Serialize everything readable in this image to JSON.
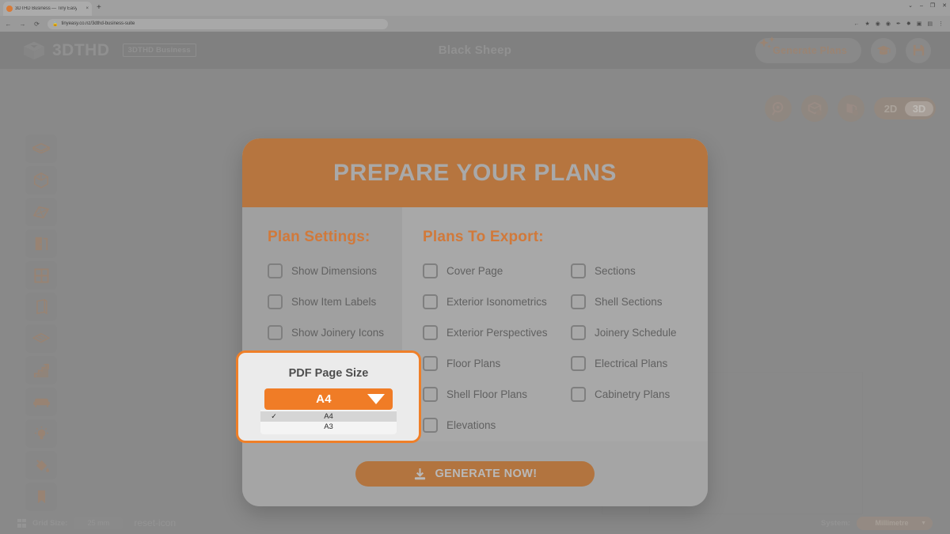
{
  "browser": {
    "tab_title": "3DTHD Business — Tiny Easy - T",
    "tab_favicon": "app-favicon",
    "close_tab": "×",
    "new_tab": "+",
    "back": "←",
    "forward": "→",
    "reload": "⟳",
    "lock": "🔒",
    "url": "tinyeasy.co.nz/3dthd-business-suite",
    "extensions": [
      "←",
      "★",
      "◉",
      "◉",
      "✒",
      "✸",
      "▣",
      "▤",
      "⋮"
    ],
    "window_buttons": [
      "⌄",
      "–",
      "❐",
      "✕"
    ]
  },
  "header": {
    "brand_name": "3DTHD",
    "brand_badge": "3DTHD Business",
    "logo_icon": "cube-logo-icon",
    "project_title": "Black Sheep",
    "generate_plans_label": "Generate Plans",
    "sparkle_icon": "sparkles-icon",
    "tutorial_icon": "graduation-cap-icon",
    "save_icon": "floppy-save-icon"
  },
  "toolrail": {
    "items": [
      {
        "name": "floor-tool",
        "icon": "floor-slab-icon"
      },
      {
        "name": "room-tool",
        "icon": "room-box-icon"
      },
      {
        "name": "roof-tool",
        "icon": "roof-icon"
      },
      {
        "name": "door-tool",
        "icon": "door-icon"
      },
      {
        "name": "window-tool",
        "icon": "window-icon"
      },
      {
        "name": "wall-tool",
        "icon": "wall-icon"
      },
      {
        "name": "deck-tool",
        "icon": "deck-icon"
      },
      {
        "name": "stairs-tool",
        "icon": "stairs-icon"
      },
      {
        "name": "furniture-tool",
        "icon": "sofa-icon"
      },
      {
        "name": "lighting-tool",
        "icon": "lightbulb-icon"
      },
      {
        "name": "paint-tool",
        "icon": "paint-bucket-icon"
      },
      {
        "name": "bookmark-tool",
        "icon": "bookmark-icon"
      }
    ]
  },
  "view_controls": {
    "measure_icon": "tape-measure-icon",
    "shell_icon": "shell-view-icon",
    "perspective_icon": "perspective-view-icon",
    "dimension_2d": "2D",
    "dimension_3d": "3D",
    "active_dimension": "3D"
  },
  "statusbar": {
    "grid_icon": "grid-icon",
    "grid_label": "Grid Size:",
    "grid_value": "25 mm",
    "reset_icon": "reset-icon",
    "system_label": "System:",
    "system_value": "Millimetre",
    "system_caret": "▼"
  },
  "modal": {
    "title": "PREPARE YOUR PLANS",
    "plan_settings": {
      "heading": "Plan Settings:",
      "options": [
        {
          "label": "Show Dimensions",
          "checked": false
        },
        {
          "label": "Show Item Labels",
          "checked": false
        },
        {
          "label": "Show Joinery Icons",
          "checked": false
        }
      ]
    },
    "plans_to_export": {
      "heading": "Plans To Export:",
      "column_one": [
        {
          "label": "Cover Page",
          "checked": false
        },
        {
          "label": "Exterior Isonometrics",
          "checked": false
        },
        {
          "label": "Exterior Perspectives",
          "checked": false
        },
        {
          "label": "Floor Plans",
          "checked": false
        },
        {
          "label": "Shell Floor Plans",
          "checked": false
        },
        {
          "label": "Elevations",
          "checked": false
        }
      ],
      "column_two": [
        {
          "label": "Sections",
          "checked": false
        },
        {
          "label": "Shell Sections",
          "checked": false
        },
        {
          "label": "Joinery Schedule",
          "checked": false
        },
        {
          "label": "Electrical Plans",
          "checked": false
        },
        {
          "label": "Cabinetry Plans",
          "checked": false
        }
      ]
    },
    "generate_now_label": "GENERATE NOW!",
    "download_icon": "download-icon"
  },
  "pdf_page_size": {
    "label": "PDF Page Size",
    "selected": "A4",
    "caret_icon": "dropdown-triangle-icon",
    "check_icon": "✓",
    "options": [
      {
        "label": "A4",
        "selected": true
      },
      {
        "label": "A3",
        "selected": false
      }
    ]
  },
  "colors": {
    "accent_orange": "#f07c26",
    "brand_brown": "#b6753f",
    "heading_orange": "#d1793a"
  }
}
